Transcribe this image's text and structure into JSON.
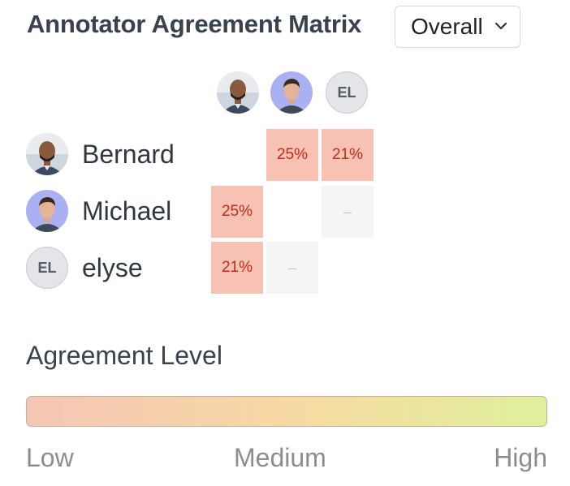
{
  "header": {
    "title": "Annotator Agreement Matrix",
    "filter": {
      "selected": "Overall",
      "icon": "chevron-down-icon"
    }
  },
  "matrix": {
    "columns": [
      {
        "avatar": "photo",
        "name": "Bernard"
      },
      {
        "avatar": "photo",
        "name": "Michael"
      },
      {
        "avatar": "initials",
        "initials": "EL",
        "name": "elyse"
      }
    ],
    "rows": [
      {
        "name": "Bernard",
        "avatar": "photo",
        "cells": [
          null,
          "25%",
          "21%"
        ]
      },
      {
        "name": "Michael",
        "avatar": "photo",
        "cells": [
          "25%",
          null,
          "–"
        ]
      },
      {
        "name": "elyse",
        "avatar": "initials",
        "initials": "EL",
        "cells": [
          "21%",
          "–",
          null
        ]
      }
    ],
    "cell_color": "#f7c1b3",
    "cell_text_color": "#c22b1a"
  },
  "legend": {
    "title": "Agreement Level",
    "low": "Low",
    "medium": "Medium",
    "high": "High",
    "gradient": [
      "#f5c6b5",
      "#f7d9a4",
      "#dff09c"
    ]
  }
}
